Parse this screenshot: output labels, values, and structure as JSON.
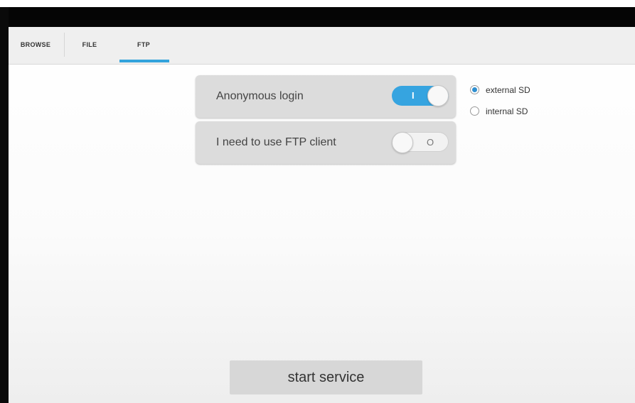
{
  "tabs": [
    {
      "label": "BROWSE"
    },
    {
      "label": "FILE"
    },
    {
      "label": "FTP",
      "selected": true
    }
  ],
  "settings": {
    "anonymous_login": {
      "label": "Anonymous login",
      "on": true,
      "mark": "I"
    },
    "ftp_client": {
      "label": "I need to use FTP client",
      "on": false,
      "mark": "O"
    }
  },
  "storage": {
    "options": [
      {
        "label": "external SD",
        "checked": true
      },
      {
        "label": "internal SD",
        "checked": false
      }
    ]
  },
  "actions": {
    "start_label": "start service"
  },
  "colors": {
    "accent": "#33a3dc",
    "toggle_on": "#36a4e0"
  }
}
